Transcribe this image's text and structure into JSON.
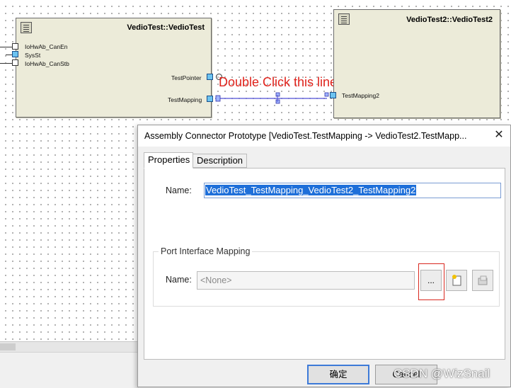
{
  "diagram": {
    "component1": {
      "title": "VedioTest::VedioTest",
      "ports_left": [
        "IoHwAb_CanEn",
        "SysSt",
        "IoHwAb_CanStb"
      ],
      "ports_right": [
        "TestPointer",
        "TestMapping"
      ]
    },
    "component2": {
      "title": "VedioTest2::VedioTest2",
      "ports_left": [
        "TestMapping2"
      ]
    },
    "hint": "Double Click  this line"
  },
  "dialog": {
    "title": "Assembly Connector Prototype [VedioTest.TestMapping -> VedioTest2.TestMapp...",
    "tabs": [
      "Properties",
      "Description"
    ],
    "name_label": "Name:",
    "name_value": "VedioTest_TestMapping_VedioTest2_TestMapping2",
    "group_title": "Port Interface Mapping",
    "mapping_label": "Name:",
    "mapping_value": "<None>",
    "browse_label": "...",
    "ok_label": "确定",
    "cancel_label": "Cancel",
    "icons": [
      "close-icon",
      "new-mapping-icon",
      "edit-mapping-icon"
    ]
  },
  "watermark": "CSDN @WizSnail",
  "colors": {
    "hint": "#e0231c",
    "selection": "#1e6fd9",
    "component": "#ecebd9",
    "port": "#6cc3f0"
  }
}
